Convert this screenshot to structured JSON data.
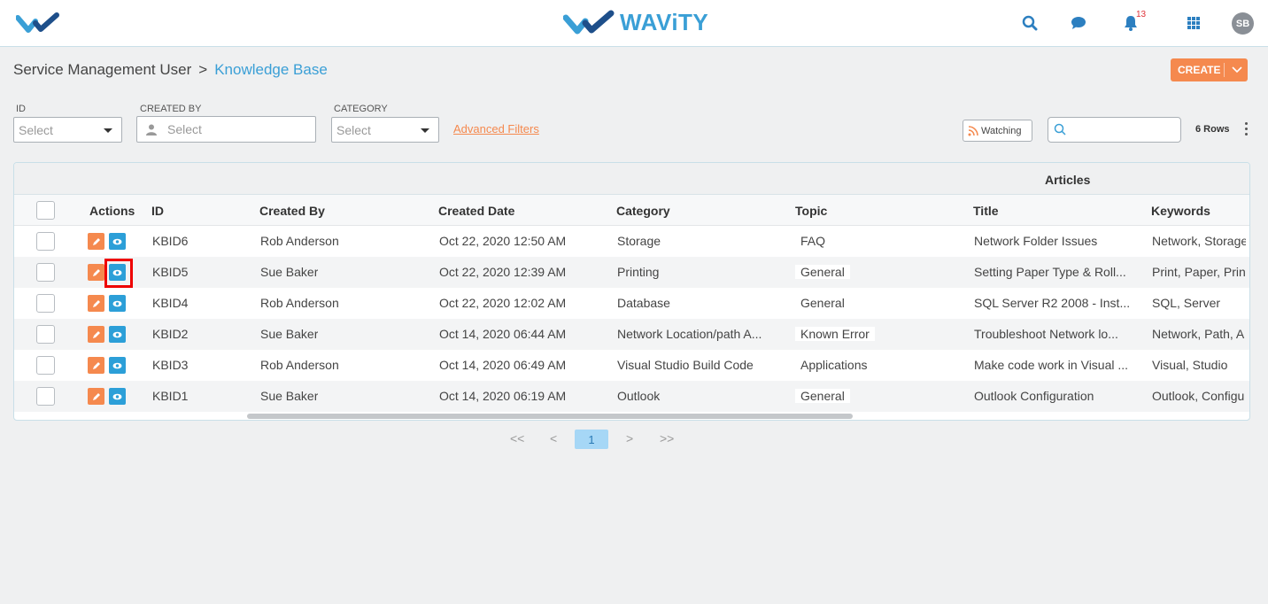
{
  "header": {
    "brand": "WAViTY",
    "notification_count": "13",
    "avatar_initials": "SB",
    "icons": [
      "logo-mark-icon",
      "search-icon",
      "chat-icon",
      "bell-icon",
      "apps-grid-icon"
    ]
  },
  "breadcrumb": {
    "parent": "Service Management User",
    "separator": ">",
    "current": "Knowledge Base"
  },
  "create_button": {
    "label": "CREATE"
  },
  "filters": {
    "id": {
      "label": "ID",
      "value": "Select"
    },
    "created_by": {
      "label": "CREATED BY",
      "placeholder": "Select"
    },
    "category": {
      "label": "CATEGORY",
      "value": "Select"
    },
    "advanced_filters": "Advanced Filters"
  },
  "toolbar": {
    "watching_label": "Watching",
    "search_placeholder": "",
    "rows_label": "6 Rows"
  },
  "table": {
    "group_header": "Articles",
    "columns": [
      "Actions",
      "ID",
      "Created By",
      "Created Date",
      "Category",
      "Topic",
      "Title",
      "Keywords"
    ],
    "rows": [
      {
        "id": "KBID6",
        "created_by": "Rob Anderson",
        "created_date": "Oct 22, 2020 12:50 AM",
        "category": "Storage",
        "topic": "FAQ",
        "title": "Network Folder Issues",
        "keywords": "Network, Storage"
      },
      {
        "id": "KBID5",
        "created_by": "Sue Baker",
        "created_date": "Oct 22, 2020 12:39 AM",
        "category": "Printing",
        "topic": "General",
        "title": "Setting Paper Type & Roll...",
        "keywords": "Print, Paper, Print"
      },
      {
        "id": "KBID4",
        "created_by": "Rob Anderson",
        "created_date": "Oct 22, 2020 12:02 AM",
        "category": "Database",
        "topic": "General",
        "title": "SQL Server R2 2008 - Inst...",
        "keywords": "SQL, Server"
      },
      {
        "id": "KBID2",
        "created_by": "Sue Baker",
        "created_date": "Oct 14, 2020 06:44 AM",
        "category": "Network Location/path A...",
        "topic": "Known Error",
        "title": "Troubleshoot Network lo...",
        "keywords": "Network, Path, A"
      },
      {
        "id": "KBID3",
        "created_by": "Rob Anderson",
        "created_date": "Oct 14, 2020 06:49 AM",
        "category": "Visual Studio Build Code",
        "topic": "Applications",
        "title": "Make code work in Visual ...",
        "keywords": "Visual, Studio"
      },
      {
        "id": "KBID1",
        "created_by": "Sue Baker",
        "created_date": "Oct 14, 2020 06:19 AM",
        "category": "Outlook",
        "topic": "General",
        "title": "Outlook Configuration",
        "keywords": "Outlook, Configu"
      }
    ]
  },
  "pagination": {
    "first": "<<",
    "prev": "<",
    "current": "1",
    "next": ">",
    "last": ">>"
  },
  "colors": {
    "accent_blue": "#3a9fd6",
    "accent_orange": "#f5894e",
    "highlight_red": "#ee0000"
  }
}
